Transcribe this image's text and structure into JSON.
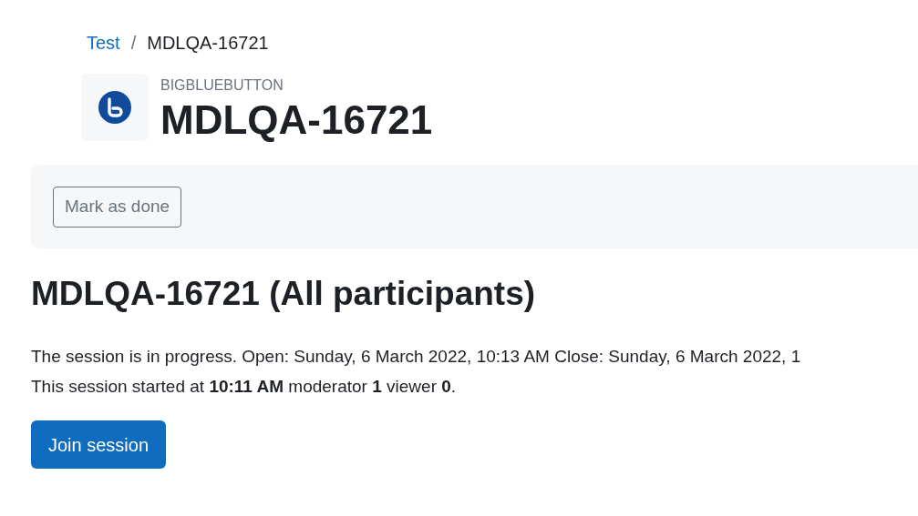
{
  "breadcrumb": [
    {
      "label": "Test",
      "kind": "link"
    },
    {
      "label": "/",
      "kind": "separator"
    },
    {
      "label": "MDLQA-16721",
      "kind": "current"
    }
  ],
  "header": {
    "module_type": "BIGBLUEBUTTON",
    "title": "MDLQA-16721"
  },
  "completion": {
    "button": "Mark as done"
  },
  "room": {
    "heading": "MDLQA-16721 (All participants)",
    "status_lines": [
      "The session is in progress. Open: Sunday, 6 March 2022, 10:13 AM Close: Sunday, 6 March 2022, 1",
      "This session started at **10:11 AM** moderator **1** viewer **0**."
    ],
    "join_button": "Join session"
  }
}
